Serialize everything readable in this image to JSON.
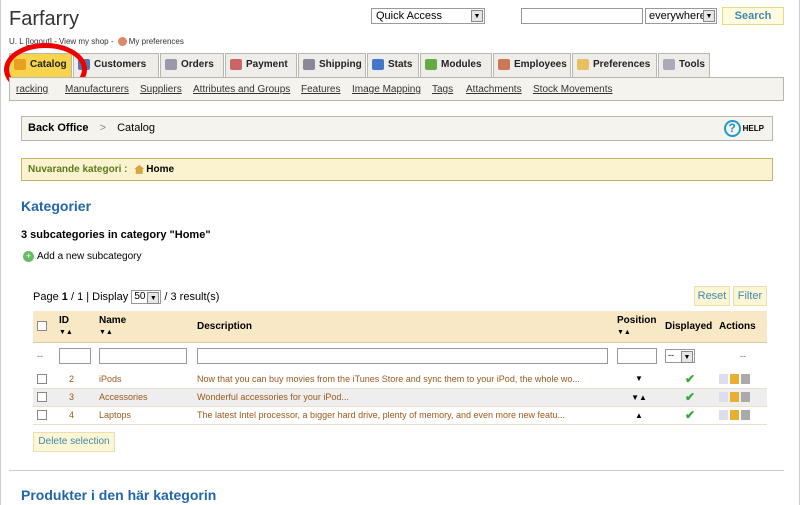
{
  "header": {
    "shop_name": "Farfarry",
    "user_prefix": "U. L",
    "logout": "logout",
    "view_shop": "View my shop",
    "preferences": "My preferences",
    "quick_access": "Quick Access",
    "search_scope": "everywhere",
    "search_button": "Search"
  },
  "tabs": [
    {
      "label": "Catalog",
      "icon": "folder-icon",
      "active": true
    },
    {
      "label": "Customers",
      "icon": "customers-icon"
    },
    {
      "label": "Orders",
      "icon": "orders-icon"
    },
    {
      "label": "Payment",
      "icon": "payment-icon"
    },
    {
      "label": "Shipping",
      "icon": "shipping-icon"
    },
    {
      "label": "Stats",
      "icon": "stats-icon"
    },
    {
      "label": "Modules",
      "icon": "modules-icon"
    },
    {
      "label": "Employees",
      "icon": "employees-icon"
    },
    {
      "label": "Preferences",
      "icon": "preferences-icon"
    },
    {
      "label": "Tools",
      "icon": "tools-icon"
    }
  ],
  "subnav": [
    "racking",
    "Manufacturers",
    "Suppliers",
    "Attributes and Groups",
    "Features",
    "Image Mapping",
    "Tags",
    "Attachments",
    "Stock Movements"
  ],
  "breadcrumb": {
    "root": "Back Office",
    "sep": ">",
    "current": "Catalog",
    "help": "HELP"
  },
  "current_category": {
    "label": "Nuvarande kategori :",
    "value": "Home"
  },
  "section_title": "Kategorier",
  "subcat_count": "3 subcategories in category \"Home\"",
  "add_subcat": "Add a new subcategory",
  "pager": {
    "page_label": "Page",
    "page": "1",
    "pages": "1",
    "display_label": "Display",
    "per_page": "50",
    "results": "/ 3 result(s)"
  },
  "buttons": {
    "reset": "Reset",
    "filter": "Filter",
    "delete_selection": "Delete selection"
  },
  "table": {
    "headers": {
      "id": "ID",
      "name": "Name",
      "description": "Description",
      "position": "Position",
      "displayed": "Displayed",
      "actions": "Actions"
    },
    "filter_dash": "--",
    "filter_select": "--",
    "rows": [
      {
        "id": "2",
        "name": "iPods",
        "description": "Now that you can buy movies from the iTunes Store and sync them to your iPod, the whole wo...",
        "position": "down",
        "displayed": true
      },
      {
        "id": "3",
        "name": "Accessories",
        "description": "Wonderful accessories for your iPod...",
        "position": "both",
        "displayed": true
      },
      {
        "id": "4",
        "name": "Laptops",
        "description": "The latest Intel processor, a bigger hard drive, plenty of memory, and even more new featu...",
        "position": "up",
        "displayed": true
      }
    ]
  },
  "section_products": "Produkter i den här kategorin",
  "colors": {
    "accent_tab": "#f7d44c",
    "link": "#2266aa",
    "row_text": "#9a5a1a",
    "highlight_circle": "#ee0000"
  }
}
